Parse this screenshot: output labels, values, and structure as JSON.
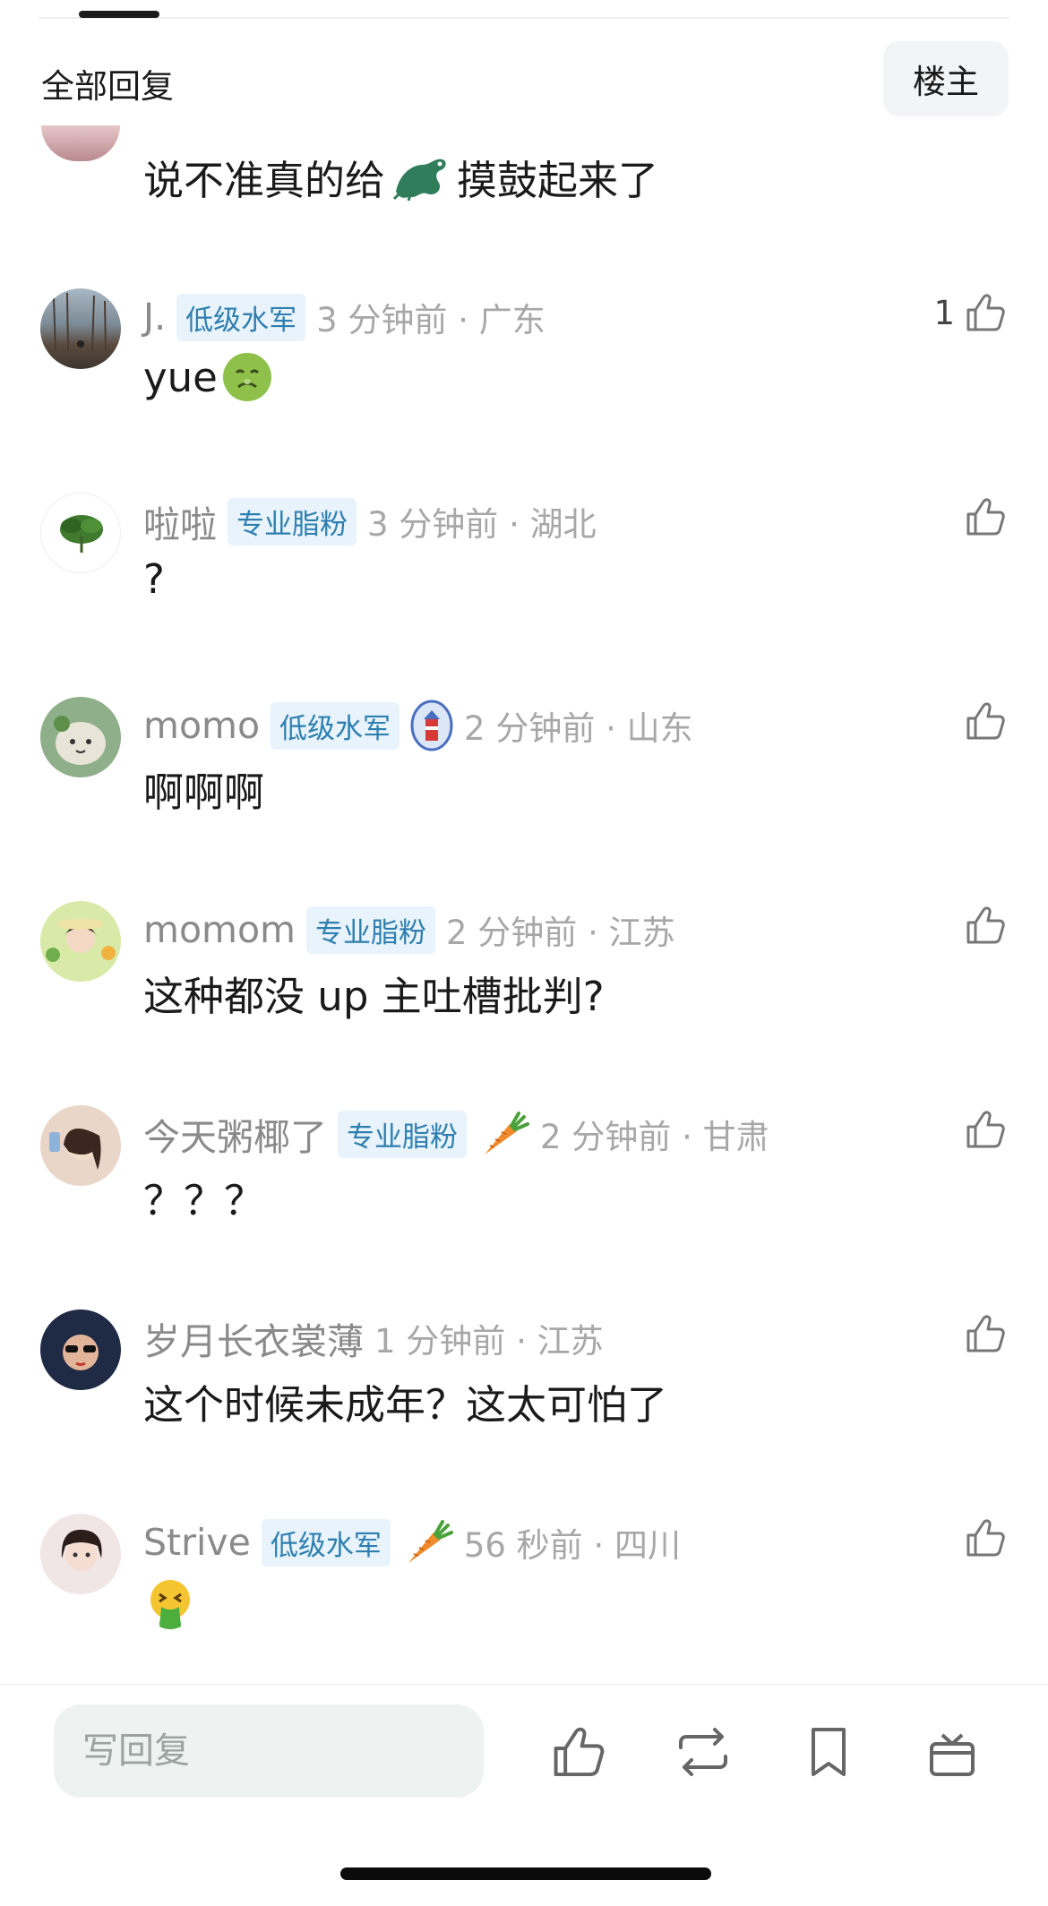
{
  "header": {
    "title": "全部回复",
    "op_button": "楼主"
  },
  "partial_comment": {
    "text_before": "说不准真的给",
    "emoji": "crocodile-emoji",
    "text_after": "摸鼓起来了"
  },
  "comments": [
    {
      "username": "J.",
      "badge": "低级水军",
      "time_location": "3 分钟前 · 广东",
      "text": "yue",
      "emoji": "nauseated-face-emoji",
      "likes": "1"
    },
    {
      "username": "啦啦",
      "badge": "专业脂粉",
      "time_location": "3 分钟前 · 湖北",
      "text": "?",
      "likes": ""
    },
    {
      "username": "momo",
      "badge": "低级水军",
      "medal": "lighthouse-medal-icon",
      "time_location": "2 分钟前 · 山东",
      "text": "啊啊啊",
      "likes": ""
    },
    {
      "username": "momom",
      "badge": "专业脂粉",
      "time_location": "2 分钟前 · 江苏",
      "text": "这种都没 up 主吐槽批判?",
      "likes": ""
    },
    {
      "username": "今天粥椰了",
      "badge": "专业脂粉",
      "medal": "carrot-icon",
      "time_location": "2 分钟前 · 甘肃",
      "text": "？？？",
      "likes": ""
    },
    {
      "username": "岁月长衣裳薄",
      "time_location": "1 分钟前 · 江苏",
      "text": "这个时候未成年？这太可怕了",
      "likes": ""
    },
    {
      "username": "Strive",
      "badge": "低级水军",
      "medal": "carrot-icon",
      "time_location": "56 秒前 · 四川",
      "text": "",
      "emoji": "vomiting-face-emoji",
      "likes": ""
    }
  ],
  "bottom_bar": {
    "reply_placeholder": "写回复",
    "icons": [
      "thumbs-up-icon",
      "repost-icon",
      "bookmark-icon",
      "gift-icon"
    ]
  },
  "colors": {
    "badge_text": "#2e7fb0",
    "badge_bg": "#e8f3fb",
    "meta_gray": "#a7a7a7",
    "input_bg": "#eef3f1"
  }
}
